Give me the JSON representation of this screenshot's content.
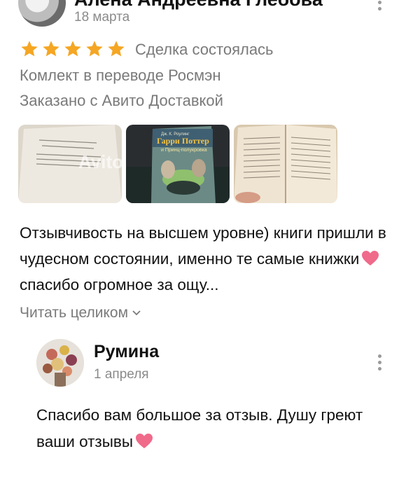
{
  "review": {
    "reviewer_name": "Алена Андреевна Глебова",
    "date": "18 марта",
    "rating": 5,
    "deal_status": "Сделка состоялась",
    "edition": "Комлект в переводе Росмэн",
    "delivery": "Заказано с Авито Доставкой",
    "text_part1": "Отзывчивость на высшем уровне) книги пришли в чудесном состоянии, именно те самые книжки",
    "text_part2": "спасибо огромное за ощу...",
    "read_more": "Читать целиком",
    "photos": [
      {
        "name": "photo-open-book-page",
        "watermark": "Avito"
      },
      {
        "name": "photo-book-cover",
        "cover_title": "Гарри Поттер",
        "cover_subtitle": "и Принц-полукровка",
        "cover_author": "Дж. К. Роулинг"
      },
      {
        "name": "photo-book-pages"
      }
    ]
  },
  "reply": {
    "seller_name": "Румина",
    "date": "1 апреля",
    "text_part1": "Спасибо вам большое  за отзыв.  Душу греют ваши отзывы"
  },
  "colors": {
    "star": "#f5a623",
    "heart": "#f06a8a",
    "muted_text": "#7a7a7a"
  },
  "icons": {
    "more": "kebab-menu-icon",
    "heart": "heart-emoji",
    "chevron": "chevron-down-icon"
  }
}
